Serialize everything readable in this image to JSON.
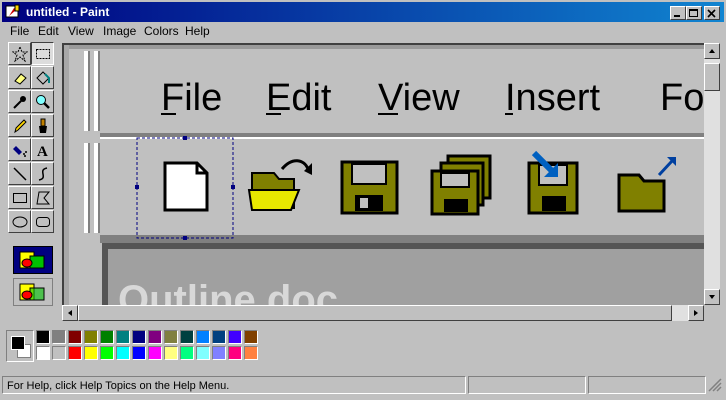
{
  "window": {
    "title": "untitled - Paint"
  },
  "menu": [
    "File",
    "Edit",
    "View",
    "Image",
    "Colors",
    "Help"
  ],
  "image_content": {
    "menu_labels": [
      "File",
      "Edit",
      "View",
      "Insert",
      "Fo"
    ],
    "doc_text": "Outline doc"
  },
  "palette": {
    "row1": [
      "#000000",
      "#808080",
      "#800000",
      "#808000",
      "#008000",
      "#008080",
      "#000080",
      "#800080",
      "#808040",
      "#004040",
      "#0080ff",
      "#004080",
      "#4000ff",
      "#804000"
    ],
    "row2": [
      "#ffffff",
      "#c0c0c0",
      "#ff0000",
      "#ffff00",
      "#00ff00",
      "#00ffff",
      "#0000ff",
      "#ff00ff",
      "#ffff80",
      "#00ff80",
      "#80ffff",
      "#8080ff",
      "#ff0080",
      "#ff8040"
    ]
  },
  "status": {
    "help_text": "For Help, click Help Topics on the Help Menu."
  }
}
